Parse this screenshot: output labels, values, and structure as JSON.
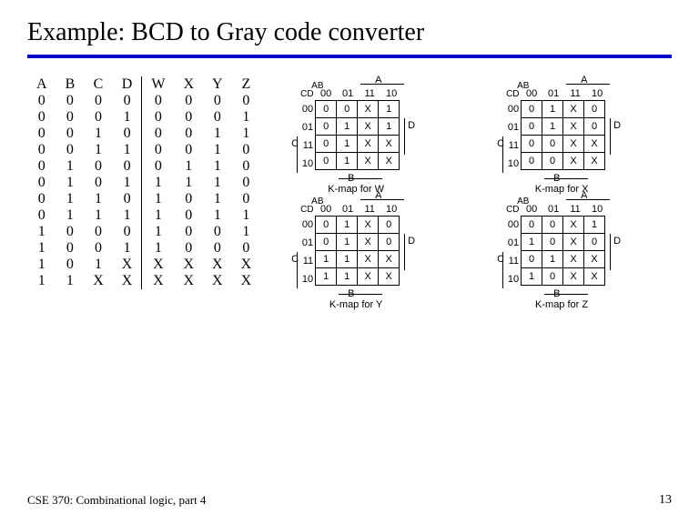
{
  "title": "Example: BCD to Gray code converter",
  "footer_left": "CSE 370: Combinational logic, part 4",
  "footer_right": "13",
  "truth_table": {
    "headers": [
      "A",
      "B",
      "C",
      "D",
      "W",
      "X",
      "Y",
      "Z"
    ],
    "rows": [
      [
        "0",
        "0",
        "0",
        "0",
        "0",
        "0",
        "0",
        "0"
      ],
      [
        "0",
        "0",
        "0",
        "1",
        "0",
        "0",
        "0",
        "1"
      ],
      [
        "0",
        "0",
        "1",
        "0",
        "0",
        "0",
        "1",
        "1"
      ],
      [
        "0",
        "0",
        "1",
        "1",
        "0",
        "0",
        "1",
        "0"
      ],
      [
        "0",
        "1",
        "0",
        "0",
        "0",
        "1",
        "1",
        "0"
      ],
      [
        "0",
        "1",
        "0",
        "1",
        "1",
        "1",
        "1",
        "0"
      ],
      [
        "0",
        "1",
        "1",
        "0",
        "1",
        "0",
        "1",
        "0"
      ],
      [
        "0",
        "1",
        "1",
        "1",
        "1",
        "0",
        "1",
        "1"
      ],
      [
        "1",
        "0",
        "0",
        "0",
        "1",
        "0",
        "0",
        "1"
      ],
      [
        "1",
        "0",
        "0",
        "1",
        "1",
        "0",
        "0",
        "0"
      ],
      [
        "1",
        "0",
        "1",
        "X",
        "X",
        "X",
        "X",
        "X"
      ],
      [
        "1",
        "1",
        "X",
        "X",
        "X",
        "X",
        "X",
        "X"
      ]
    ]
  },
  "kmap_labels": {
    "AB": "AB",
    "CD": "CD",
    "A": "A",
    "B": "B",
    "C": "C",
    "D": "D",
    "cols": [
      "00",
      "01",
      "11",
      "10"
    ],
    "rows": [
      "00",
      "01",
      "11",
      "10"
    ]
  },
  "kmaps": [
    {
      "caption": "K-map for W",
      "cells": [
        [
          "0",
          "0",
          "X",
          "1"
        ],
        [
          "0",
          "1",
          "X",
          "1"
        ],
        [
          "0",
          "1",
          "X",
          "X"
        ],
        [
          "0",
          "1",
          "X",
          "X"
        ]
      ]
    },
    {
      "caption": "K-map for X",
      "cells": [
        [
          "0",
          "1",
          "X",
          "0"
        ],
        [
          "0",
          "1",
          "X",
          "0"
        ],
        [
          "0",
          "0",
          "X",
          "X"
        ],
        [
          "0",
          "0",
          "X",
          "X"
        ]
      ]
    },
    {
      "caption": "K-map for Y",
      "cells": [
        [
          "0",
          "1",
          "X",
          "0"
        ],
        [
          "0",
          "1",
          "X",
          "0"
        ],
        [
          "1",
          "1",
          "X",
          "X"
        ],
        [
          "1",
          "1",
          "X",
          "X"
        ]
      ]
    },
    {
      "caption": "K-map for Z",
      "cells": [
        [
          "0",
          "0",
          "X",
          "1"
        ],
        [
          "1",
          "0",
          "X",
          "0"
        ],
        [
          "0",
          "1",
          "X",
          "X"
        ],
        [
          "1",
          "0",
          "X",
          "X"
        ]
      ]
    }
  ],
  "chart_data": [
    {
      "type": "table",
      "title": "K-map for W",
      "row_labels": [
        "00",
        "01",
        "11",
        "10"
      ],
      "col_labels": [
        "00",
        "01",
        "11",
        "10"
      ],
      "cells": [
        [
          "0",
          "0",
          "X",
          "1"
        ],
        [
          "0",
          "1",
          "X",
          "1"
        ],
        [
          "0",
          "1",
          "X",
          "X"
        ],
        [
          "0",
          "1",
          "X",
          "X"
        ]
      ]
    },
    {
      "type": "table",
      "title": "K-map for X",
      "row_labels": [
        "00",
        "01",
        "11",
        "10"
      ],
      "col_labels": [
        "00",
        "01",
        "11",
        "10"
      ],
      "cells": [
        [
          "0",
          "1",
          "X",
          "0"
        ],
        [
          "0",
          "1",
          "X",
          "0"
        ],
        [
          "0",
          "0",
          "X",
          "X"
        ],
        [
          "0",
          "0",
          "X",
          "X"
        ]
      ]
    },
    {
      "type": "table",
      "title": "K-map for Y",
      "row_labels": [
        "00",
        "01",
        "11",
        "10"
      ],
      "col_labels": [
        "00",
        "01",
        "11",
        "10"
      ],
      "cells": [
        [
          "0",
          "1",
          "X",
          "0"
        ],
        [
          "0",
          "1",
          "X",
          "0"
        ],
        [
          "1",
          "1",
          "X",
          "X"
        ],
        [
          "1",
          "1",
          "X",
          "X"
        ]
      ]
    },
    {
      "type": "table",
      "title": "K-map for Z",
      "row_labels": [
        "00",
        "01",
        "11",
        "10"
      ],
      "col_labels": [
        "00",
        "01",
        "11",
        "10"
      ],
      "cells": [
        [
          "0",
          "0",
          "X",
          "1"
        ],
        [
          "1",
          "0",
          "X",
          "0"
        ],
        [
          "0",
          "1",
          "X",
          "X"
        ],
        [
          "1",
          "0",
          "X",
          "X"
        ]
      ]
    }
  ]
}
